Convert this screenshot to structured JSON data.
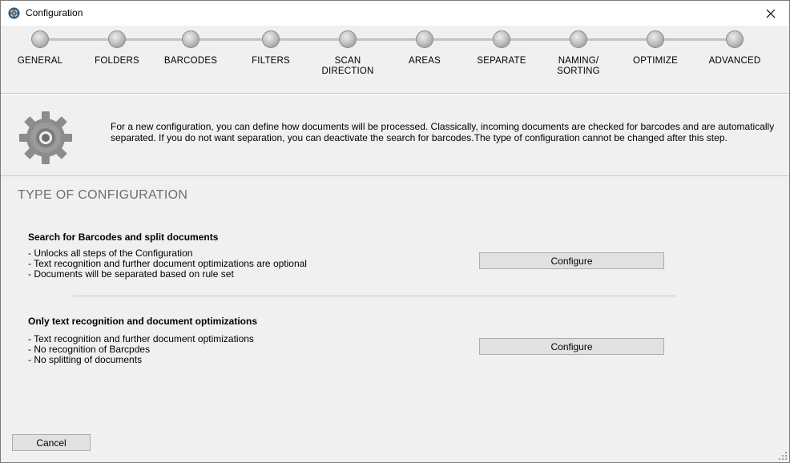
{
  "window": {
    "title": "Configuration"
  },
  "steps": [
    {
      "label": "GENERAL"
    },
    {
      "label": "FOLDERS"
    },
    {
      "label": "BARCODES"
    },
    {
      "label": "FILTERS"
    },
    {
      "label": "SCAN\nDIRECTION"
    },
    {
      "label": "AREAS"
    },
    {
      "label": "SEPARATE"
    },
    {
      "label": "NAMING/\nSORTING"
    },
    {
      "label": "OPTIMIZE"
    },
    {
      "label": "ADVANCED"
    }
  ],
  "info": {
    "text": "For a new configuration, you can define how documents will be processed.  Classically, incoming documents are checked for barcodes and are automatically separated. If you do not want separation, you can deactivate the search for barcodes.The type of configuration cannot be changed after this step.",
    "icon": "gear-icon"
  },
  "section": {
    "title": "TYPE OF CONFIGURATION"
  },
  "options": [
    {
      "heading": "Search for Barcodes and split documents",
      "lines": [
        "- Unlocks all steps of the Configuration",
        "- Text recognition and further document optimizations are optional",
        "- Documents will be separated based on rule set"
      ],
      "button": "Configure"
    },
    {
      "heading": "Only text recognition and document optimizations",
      "lines": [
        "- Text recognition and further document optimizations",
        "- No recognition of Barcpdes",
        "- No splitting of documents"
      ],
      "button": "Configure"
    }
  ],
  "footer": {
    "cancel": "Cancel"
  }
}
